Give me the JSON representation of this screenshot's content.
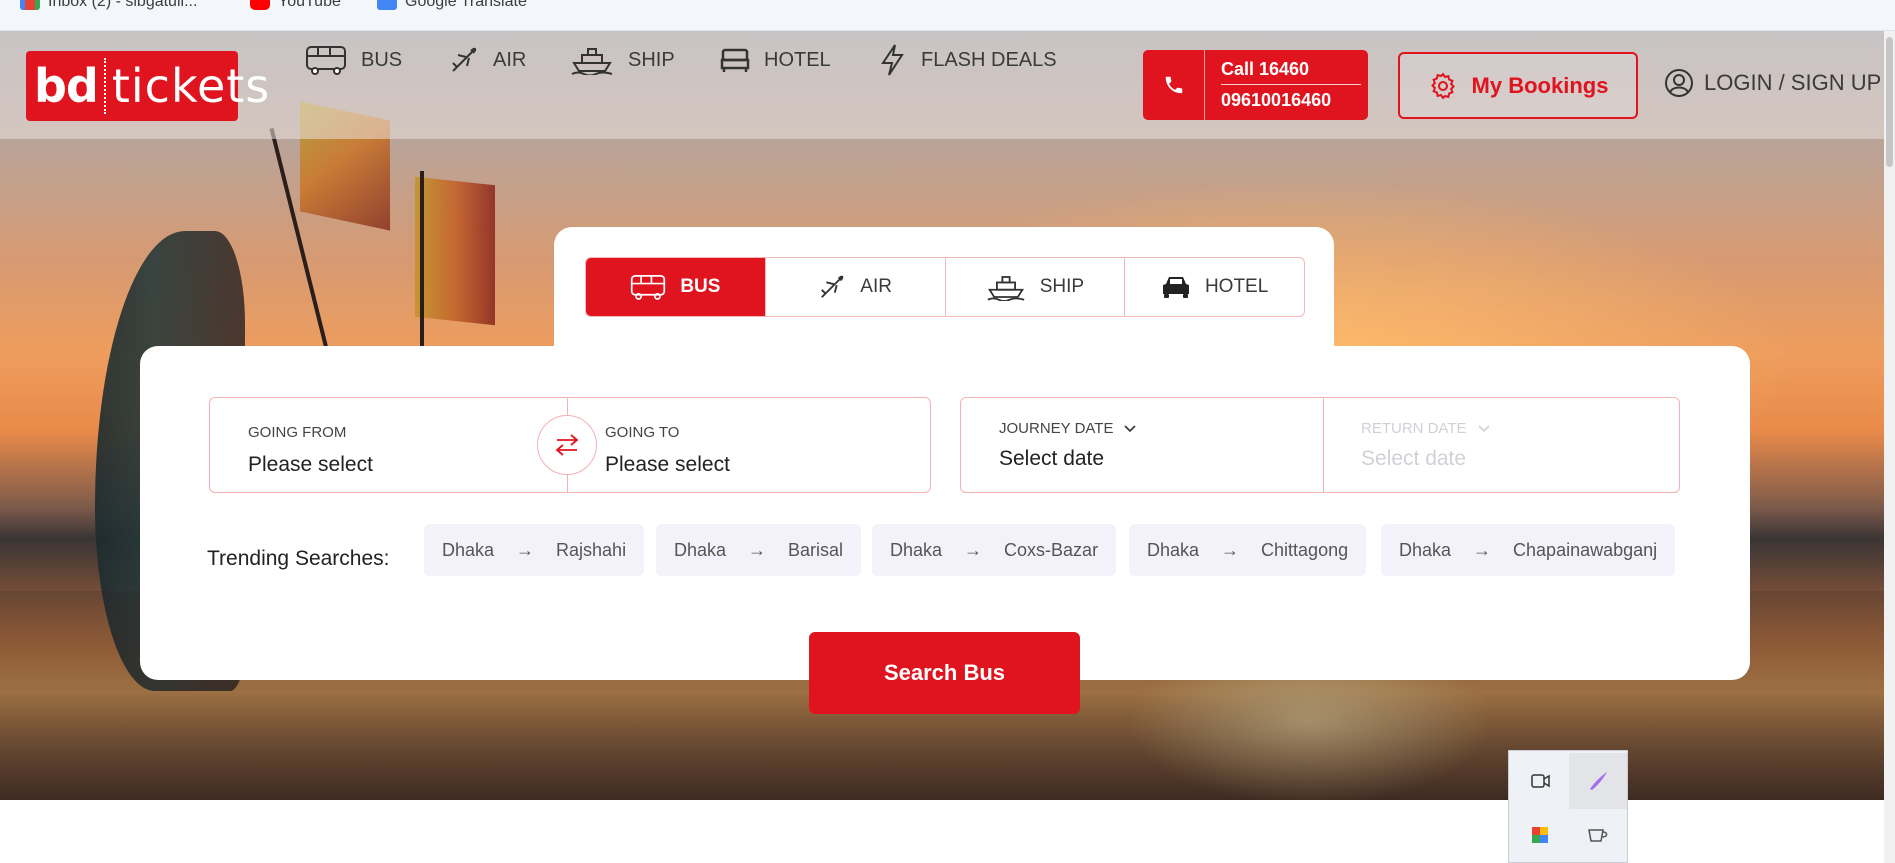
{
  "browser": {
    "bookmarks": [
      {
        "label": "Inbox (2) - sibgatull...",
        "icon": "gmail-icon",
        "color": "#d93025"
      },
      {
        "label": "YouTube",
        "icon": "youtube-icon",
        "color": "#ff0000"
      },
      {
        "label": "Google Translate",
        "icon": "translate-icon",
        "color": "#4285f4"
      }
    ]
  },
  "brand": {
    "part1": "bd",
    "part2": "tickets",
    "color": "#e0141e"
  },
  "nav": {
    "items": [
      {
        "label": "BUS",
        "icon": "bus-icon"
      },
      {
        "label": "AIR",
        "icon": "plane-icon"
      },
      {
        "label": "SHIP",
        "icon": "ship-icon"
      },
      {
        "label": "HOTEL",
        "icon": "bed-icon"
      },
      {
        "label": "FLASH DEALS",
        "icon": "lightning-icon"
      }
    ],
    "call_line1": "Call 16460",
    "call_line2": "09610016460",
    "my_bookings": "My Bookings",
    "login": "LOGIN / SIGN UP"
  },
  "search": {
    "tabs": [
      {
        "label": "BUS",
        "icon": "bus-icon",
        "active": true
      },
      {
        "label": "AIR",
        "icon": "plane-icon",
        "active": false
      },
      {
        "label": "SHIP",
        "icon": "ship-icon",
        "active": false
      },
      {
        "label": "HOTEL",
        "icon": "car-icon",
        "active": false
      }
    ],
    "going_from": {
      "label": "GOING FROM",
      "value": "Please select"
    },
    "going_to": {
      "label": "GOING TO",
      "value": "Please select"
    },
    "journey_date": {
      "label": "JOURNEY DATE",
      "value": "Select date"
    },
    "return_date": {
      "label": "RETURN DATE",
      "value": "Select date"
    },
    "trending_label": "Trending Searches:",
    "trending": [
      {
        "from": "Dhaka",
        "to": "Rajshahi"
      },
      {
        "from": "Dhaka",
        "to": "Barisal"
      },
      {
        "from": "Dhaka",
        "to": "Coxs-Bazar"
      },
      {
        "from": "Dhaka",
        "to": "Chittagong"
      },
      {
        "from": "Dhaka",
        "to": "Chapainawabganj"
      }
    ],
    "button": "Search Bus"
  },
  "tray": {
    "icons": [
      "meet-now-icon",
      "pen-icon",
      "color-palette-icon",
      "coffee-cup-icon"
    ]
  }
}
